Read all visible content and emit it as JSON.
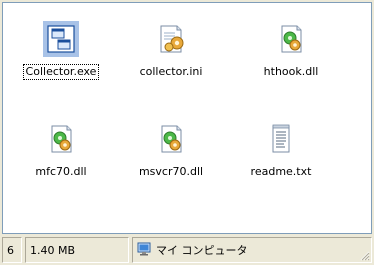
{
  "window": {
    "files": [
      {
        "name": "Collector.exe",
        "icon": "application-icon",
        "selected": true
      },
      {
        "name": "collector.ini",
        "icon": "settings-file-icon",
        "selected": false
      },
      {
        "name": "hthook.dll",
        "icon": "dll-file-icon",
        "selected": false
      },
      {
        "name": "mfc70.dll",
        "icon": "dll-file-icon",
        "selected": false
      },
      {
        "name": "msvcr70.dll",
        "icon": "dll-file-icon",
        "selected": false
      },
      {
        "name": "readme.txt",
        "icon": "text-file-icon",
        "selected": false
      }
    ]
  },
  "statusbar": {
    "object_count": "6",
    "size": "1.40 MB",
    "location": "マイ コンピュータ",
    "location_icon": "my-computer-icon"
  }
}
